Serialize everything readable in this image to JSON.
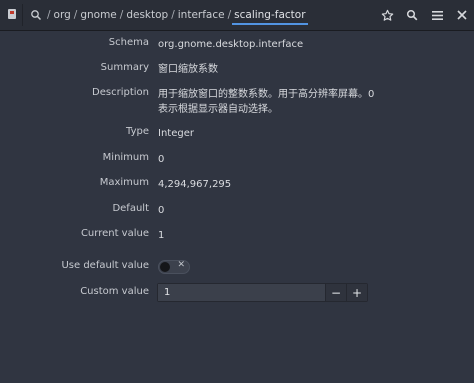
{
  "header": {
    "path_segments": [
      "org",
      "gnome",
      "desktop",
      "interface"
    ],
    "current_segment": "scaling-factor"
  },
  "fields": {
    "schema": {
      "label": "Schema",
      "value": "org.gnome.desktop.interface"
    },
    "summary": {
      "label": "Summary",
      "value": "窗口缩放系数"
    },
    "description": {
      "label": "Description",
      "value": "用于缩放窗口的整数系数。用于高分辨率屏幕。0 表示根据显示器自动选择。"
    },
    "type": {
      "label": "Type",
      "value": "Integer"
    },
    "minimum": {
      "label": "Minimum",
      "value": "0"
    },
    "maximum": {
      "label": "Maximum",
      "value": "4,294,967,295"
    },
    "default": {
      "label": "Default",
      "value": "0"
    },
    "current": {
      "label": "Current value",
      "value": "1"
    },
    "use_default": {
      "label": "Use default value",
      "state": "off",
      "off_glyph": "✕"
    },
    "custom": {
      "label": "Custom value",
      "value": "1",
      "minus": "−",
      "plus": "+"
    }
  },
  "colors": {
    "window_bg": "#303541",
    "header_bg": "#2a2e37",
    "accent": "#5294e2"
  },
  "icons": [
    "dconf-app-icon",
    "search-history-icon",
    "star-icon",
    "search-icon",
    "menu-icon",
    "close-icon"
  ]
}
